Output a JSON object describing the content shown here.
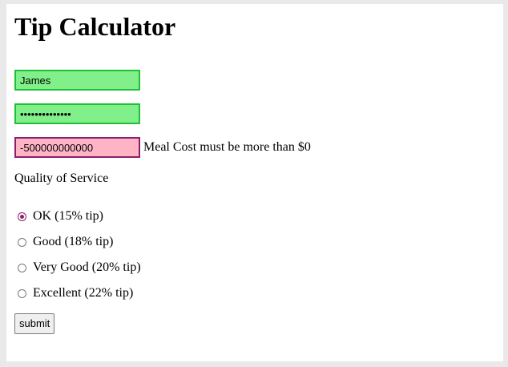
{
  "title": "Tip Calculator",
  "form": {
    "name_value": "James",
    "password_value": "••••••••••••••",
    "meal_cost_value": "-500000000000",
    "meal_cost_error": "Meal Cost must be more than $0",
    "quality_label": "Quality of Service",
    "options": [
      {
        "label": "OK (15% tip)",
        "checked": true
      },
      {
        "label": "Good (18% tip)",
        "checked": false
      },
      {
        "label": "Very Good (20% tip)",
        "checked": false
      },
      {
        "label": "Excellent (22% tip)",
        "checked": false
      }
    ],
    "submit_label": "submit"
  },
  "colors": {
    "valid_field_bg": "#81f08a",
    "valid_field_border": "#1fbf3a",
    "invalid_field_bg": "#ffb4c6",
    "invalid_field_border": "#8b1f6e",
    "radio_accent": "#8b1f6e"
  }
}
